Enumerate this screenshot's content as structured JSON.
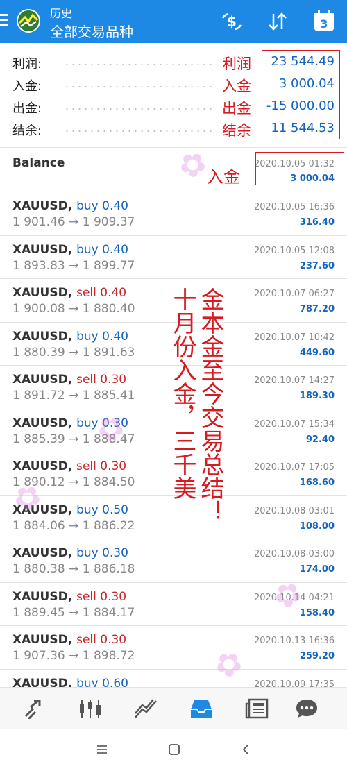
{
  "header": {
    "subtitle": "历史",
    "title": "全部交易品种",
    "calendar_day": "3"
  },
  "summary": [
    {
      "label": "利润:",
      "annotation": "利润",
      "value": "23 544.49"
    },
    {
      "label": "入金:",
      "annotation": "入金",
      "value": "3 000.04"
    },
    {
      "label": "出金:",
      "annotation": "出金",
      "value": "-15 000.00"
    },
    {
      "label": "结余:",
      "annotation": "结余",
      "value": "11 544.53"
    }
  ],
  "balance": {
    "label": "Balance",
    "annotation": "入金",
    "date": "2020.10.05 01:32",
    "amount": "3 000.04"
  },
  "trades": [
    {
      "symbol": "XAUUSD,",
      "side": "buy",
      "volume": "buy 0.40",
      "prices": "1 901.46 → 1 909.37",
      "date": "2020.10.05 16:36",
      "profit": "316.40"
    },
    {
      "symbol": "XAUUSD,",
      "side": "buy",
      "volume": "buy 0.40",
      "prices": "1 893.83 → 1 899.77",
      "date": "2020.10.05 12:08",
      "profit": "237.60"
    },
    {
      "symbol": "XAUUSD,",
      "side": "sell",
      "volume": "sell 0.40",
      "prices": "1 900.08 → 1 880.40",
      "date": "2020.10.07 06:27",
      "profit": "787.20"
    },
    {
      "symbol": "XAUUSD,",
      "side": "buy",
      "volume": "buy 0.40",
      "prices": "1 880.39 → 1 891.63",
      "date": "2020.10.07 10:42",
      "profit": "449.60"
    },
    {
      "symbol": "XAUUSD,",
      "side": "sell",
      "volume": "sell 0.30",
      "prices": "1 891.72 → 1 885.41",
      "date": "2020.10.07 14:27",
      "profit": "189.30"
    },
    {
      "symbol": "XAUUSD,",
      "side": "buy",
      "volume": "buy 0.30",
      "prices": "1 885.39 → 1 888.47",
      "date": "2020.10.07 15:34",
      "profit": "92.40"
    },
    {
      "symbol": "XAUUSD,",
      "side": "sell",
      "volume": "sell 0.30",
      "prices": "1 890.12 → 1 884.50",
      "date": "2020.10.07 17:05",
      "profit": "168.60"
    },
    {
      "symbol": "XAUUSD,",
      "side": "buy",
      "volume": "buy 0.50",
      "prices": "1 884.06 → 1 886.22",
      "date": "2020.10.08 03:01",
      "profit": "108.00"
    },
    {
      "symbol": "XAUUSD,",
      "side": "buy",
      "volume": "buy 0.30",
      "prices": "1 880.38 → 1 886.18",
      "date": "2020.10.08 03:00",
      "profit": "174.00"
    },
    {
      "symbol": "XAUUSD,",
      "side": "sell",
      "volume": "sell 0.30",
      "prices": "1 889.45 → 1 884.17",
      "date": "2020.10.14 04:21",
      "profit": "158.40"
    },
    {
      "symbol": "XAUUSD,",
      "side": "sell",
      "volume": "sell 0.30",
      "prices": "1 907.36 → 1 898.72",
      "date": "2020.10.13 16:36",
      "profit": "259.20"
    },
    {
      "symbol": "XAUUSD,",
      "side": "buy",
      "volume": "buy 0.60",
      "prices": "",
      "date": "2020.10.09 17:35",
      "profit": ""
    }
  ],
  "annotations": {
    "left_column": "十月份入金，三千美",
    "right_column": "金本金至今交易总结！"
  },
  "colors": {
    "header_bg": "#1e88e5",
    "buy": "#1565c0",
    "sell": "#c62828",
    "annotation_red": "#d71920",
    "active_nav": "#1e88e5"
  },
  "bottom_nav": {
    "items": [
      "trade-icon",
      "quotes-chart-icon",
      "chart-icon",
      "history-icon",
      "news-icon",
      "chat-icon"
    ],
    "active": "history-icon"
  }
}
